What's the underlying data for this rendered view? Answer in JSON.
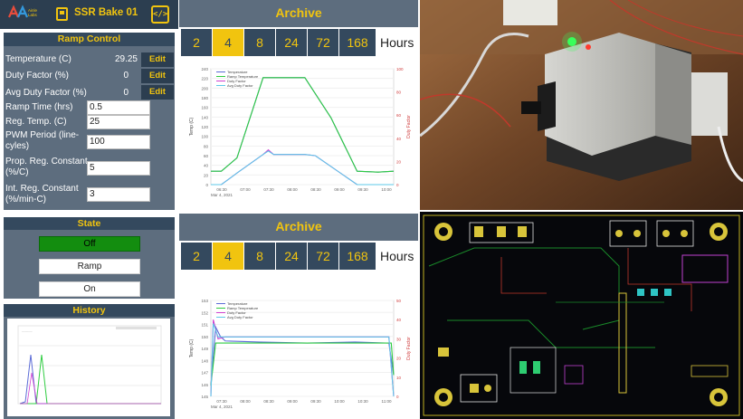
{
  "app": {
    "device_name": "SSR Bake 01",
    "logo_text": "Ainley Labs",
    "code_icon": "</>"
  },
  "colors": {
    "accent": "#f1c40f",
    "header": "#34495e",
    "panel": "#5d6d7e",
    "state_on": "#138d0f"
  },
  "ramp_control": {
    "title": "Ramp Control",
    "readouts": [
      {
        "label": "Temperature (C)",
        "value": "29.25",
        "button": "Edit"
      },
      {
        "label": "Duty Factor (%)",
        "value": "0",
        "button": "Edit"
      },
      {
        "label": "Avg Duty Factor (%)",
        "value": "0",
        "button": "Edit"
      }
    ],
    "inputs": [
      {
        "label": "Ramp Time (hrs)",
        "value": "0.5"
      },
      {
        "label": "Reg. Temp. (C)",
        "value": "25"
      },
      {
        "label": "PWM Period (line-cyles)",
        "value": "100"
      },
      {
        "label": "Prop. Reg. Constant (%/C)",
        "value": "5"
      },
      {
        "label": "Int. Reg. Constant (%/min-C)",
        "value": "3"
      }
    ]
  },
  "state": {
    "title": "State",
    "buttons": [
      "Off",
      "Ramp",
      "On"
    ],
    "active": "Off"
  },
  "history": {
    "title": "History"
  },
  "archive_top": {
    "title": "Archive",
    "hours_options": [
      "2",
      "4",
      "8",
      "24",
      "72",
      "168"
    ],
    "selected": "4",
    "hours_label": "Hours"
  },
  "archive_bottom": {
    "title": "Archive",
    "hours_options": [
      "2",
      "4",
      "8",
      "24",
      "72",
      "168"
    ],
    "selected": "4",
    "hours_label": "Hours"
  },
  "chart_data": [
    {
      "type": "line",
      "ylabel": "Temp (C)",
      "y2label": "Duty Factor",
      "ylim": [
        0,
        260
      ],
      "y2lim": [
        0,
        100
      ],
      "yticks": [
        "0",
        "20",
        "40",
        "60",
        "80",
        "100",
        "120",
        "140",
        "160",
        "180",
        "200",
        "220",
        "240"
      ],
      "y2ticks": [
        "0",
        "20",
        "40",
        "60",
        "80",
        "100"
      ],
      "xticks": [
        "06:30",
        "07:00",
        "07:30",
        "08:00",
        "08:30",
        "09:00",
        "09:30",
        "10:00"
      ],
      "xdate": "Mar 4, 2021",
      "legend": "top-left",
      "series": [
        {
          "name": "Temperature",
          "color": "#5b6bd6",
          "values": [
            [
              0,
              30
            ],
            [
              0.2,
              30
            ],
            [
              0.5,
              60
            ],
            [
              1.0,
              240
            ],
            [
              1.8,
              240
            ],
            [
              2.3,
              150
            ],
            [
              2.8,
              30
            ],
            [
              3.2,
              28
            ],
            [
              3.5,
              30
            ]
          ]
        },
        {
          "name": "Ramp Temperature",
          "color": "#2ecc40",
          "values": [
            [
              0,
              30
            ],
            [
              0.2,
              30
            ],
            [
              0.5,
              60
            ],
            [
              1.0,
              240
            ],
            [
              1.8,
              240
            ],
            [
              2.3,
              150
            ],
            [
              2.8,
              30
            ],
            [
              3.2,
              28
            ],
            [
              3.5,
              30
            ]
          ]
        },
        {
          "name": "Duty Factor",
          "color": "#d040d0",
          "values": [
            [
              0,
              0
            ],
            [
              0.2,
              0
            ],
            [
              0.5,
              10
            ],
            [
              1.0,
              26
            ],
            [
              1.1,
              30
            ],
            [
              1.2,
              26
            ],
            [
              1.8,
              26
            ],
            [
              2.0,
              25
            ],
            [
              2.8,
              0
            ],
            [
              3.5,
              0
            ]
          ]
        },
        {
          "name": "Avg Duty Factor",
          "color": "#5ec8e8",
          "values": [
            [
              0,
              0
            ],
            [
              0.2,
              0
            ],
            [
              0.5,
              10
            ],
            [
              1.0,
              26
            ],
            [
              1.1,
              29
            ],
            [
              1.2,
              26
            ],
            [
              1.8,
              26
            ],
            [
              2.0,
              25
            ],
            [
              2.8,
              0
            ],
            [
              3.5,
              0
            ]
          ]
        }
      ]
    },
    {
      "type": "line",
      "ylabel": "Temp (C)",
      "y2label": "Duty Factor",
      "ylim": [
        145,
        154
      ],
      "y2lim": [
        0,
        50
      ],
      "yticks": [
        "145",
        "146",
        "147",
        "148",
        "149",
        "150",
        "151",
        "152",
        "153"
      ],
      "y2ticks": [
        "0",
        "10",
        "20",
        "30",
        "40",
        "50"
      ],
      "xticks": [
        "07:30",
        "08:00",
        "08:30",
        "09:00",
        "09:30",
        "10:00",
        "10:30",
        "11:00"
      ],
      "xdate": "Mar 4, 2021",
      "legend": "top-left",
      "series": [
        {
          "name": "Temperature",
          "color": "#5b6bd6",
          "values": [
            [
              0,
              146
            ],
            [
              0.1,
              151.5
            ],
            [
              0.2,
              150.6
            ],
            [
              0.3,
              150.2
            ],
            [
              1.0,
              150.1
            ],
            [
              2.0,
              150.0
            ],
            [
              3.0,
              150.1
            ],
            [
              3.7,
              150.0
            ],
            [
              3.8,
              147
            ]
          ]
        },
        {
          "name": "Ramp Temperature",
          "color": "#2ecc40",
          "values": [
            [
              0,
              146
            ],
            [
              0.1,
              150
            ],
            [
              3.75,
              150
            ],
            [
              3.8,
              147
            ]
          ]
        },
        {
          "name": "Duty Factor",
          "color": "#d040d0",
          "values": [
            [
              0,
              0
            ],
            [
              0.05,
              40
            ],
            [
              0.15,
              30
            ],
            [
              0.3,
              31
            ],
            [
              3.7,
              31
            ],
            [
              3.8,
              0
            ]
          ]
        },
        {
          "name": "Avg Duty Factor",
          "color": "#5ec8e8",
          "values": [
            [
              0,
              0
            ],
            [
              0.05,
              38
            ],
            [
              0.15,
              31
            ],
            [
              0.3,
              31
            ],
            [
              3.7,
              31
            ],
            [
              3.8,
              0
            ]
          ]
        }
      ]
    }
  ]
}
